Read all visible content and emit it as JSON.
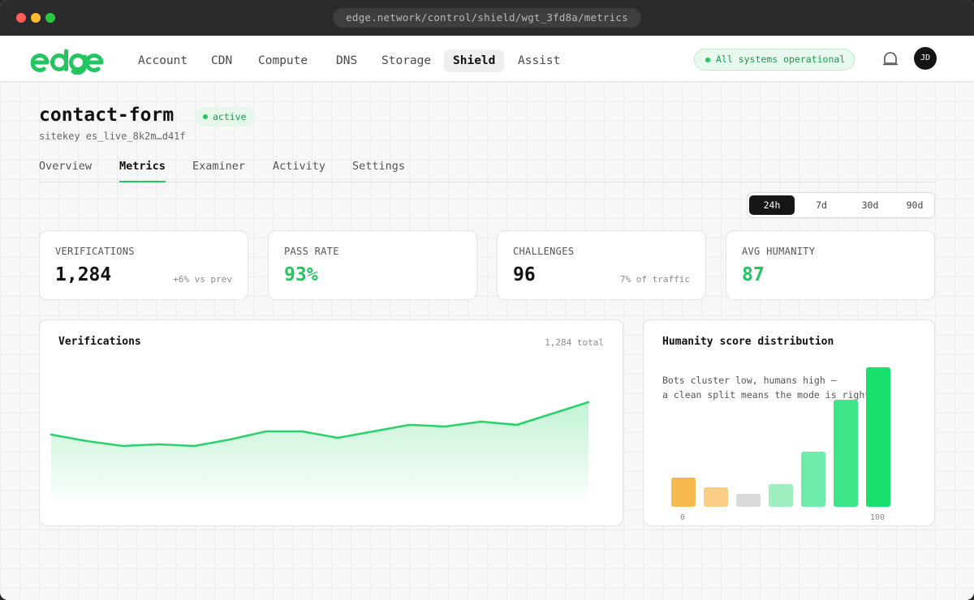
{
  "browser": {
    "url": "edge.network/control/shield/wgt_3fd8a/metrics"
  },
  "topnav": {
    "logo_text": "edge",
    "items": [
      {
        "label": "Account",
        "active": false
      },
      {
        "label": "CDN",
        "active": false
      },
      {
        "label": "Compute",
        "active": false
      },
      {
        "label": "DNS",
        "active": false
      },
      {
        "label": "Storage",
        "active": false
      },
      {
        "label": "Shield",
        "active": true
      },
      {
        "label": "Assist",
        "active": false
      }
    ],
    "status": "All systems operational",
    "avatar_initials": "JD",
    "bell_icon": "bell-icon"
  },
  "widget": {
    "name": "contact-form",
    "status": "active",
    "sitekey": "sitekey es_live_8k2m…d41f"
  },
  "tabs": [
    {
      "label": "Overview",
      "active": false
    },
    {
      "label": "Metrics",
      "active": true
    },
    {
      "label": "Examiner",
      "active": false
    },
    {
      "label": "Activity",
      "active": false
    },
    {
      "label": "Settings",
      "active": false
    }
  ],
  "time_range": {
    "options": [
      "24h",
      "7d",
      "30d",
      "90d"
    ],
    "selected": "24h"
  },
  "stats": [
    {
      "label": "VERIFICATIONS",
      "value": "1,284",
      "note": "+6% vs prev",
      "accent": false
    },
    {
      "label": "PASS RATE",
      "value": "93%",
      "note": "",
      "accent": true
    },
    {
      "label": "CHALLENGES",
      "value": "96",
      "note": "7% of traffic",
      "accent": false
    },
    {
      "label": "AVG HUMANITY",
      "value": "87",
      "note": "",
      "accent": true
    }
  ],
  "colors": {
    "accent": "#22c55e",
    "line": "#2bd16a"
  },
  "chart_data": [
    {
      "type": "area",
      "title": "Verifications",
      "total_label": "1,284 total",
      "values": [
        42,
        38,
        35,
        36,
        35,
        39,
        44,
        44,
        40,
        44,
        48,
        47,
        50,
        48,
        55,
        62
      ],
      "ylim": [
        0,
        100
      ]
    },
    {
      "type": "bar",
      "title": "Humanity score distribution",
      "caption_lines": [
        "Bots cluster low, humans high —",
        "a clean split means the mode is right."
      ],
      "x_start_label": "0",
      "x_end_label": "100",
      "values": [
        9,
        6,
        4,
        7,
        17,
        33,
        43
      ],
      "bar_colors": [
        "#f6b94e",
        "#f9cd86",
        "#d9d9d9",
        "#9fefbe",
        "#6cebab",
        "#3ee586",
        "#18e06c"
      ],
      "ylim": [
        0,
        43
      ]
    }
  ]
}
